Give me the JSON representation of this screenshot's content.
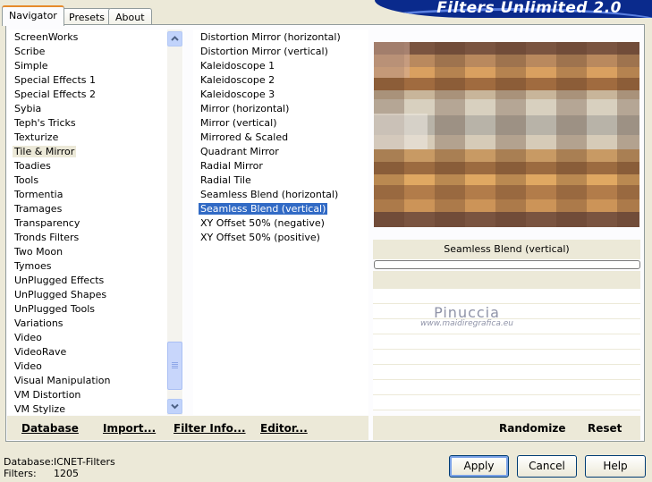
{
  "tabs": [
    {
      "label": "Navigator",
      "active": true
    },
    {
      "label": "Presets",
      "active": false
    },
    {
      "label": "About",
      "active": false
    }
  ],
  "banner_title": "Filters Unlimited 2.0",
  "categories": [
    "ScreenWorks",
    "Scribe",
    "Simple",
    "Special Effects 1",
    "Special Effects 2",
    "Sybia",
    "Teph's Tricks",
    "Texturize",
    "Tile & Mirror",
    "Toadies",
    "Tools",
    "Tormentia",
    "Tramages",
    "Transparency",
    "Tronds Filters",
    "Two Moon",
    "Tymoes",
    "UnPlugged Effects",
    "UnPlugged Shapes",
    "UnPlugged Tools",
    "Variations",
    "Video",
    "VideoRave",
    "Video",
    "Visual Manipulation",
    "VM Distortion",
    "VM Stylize"
  ],
  "selected_category": "Tile & Mirror",
  "filters": [
    "Distortion Mirror (horizontal)",
    "Distortion Mirror (vertical)",
    "Kaleidoscope 1",
    "Kaleidoscope 2",
    "Kaleidoscope 3",
    "Mirror (horizontal)",
    "Mirror (vertical)",
    "Mirrored & Scaled",
    "Quadrant Mirror",
    "Radial Mirror",
    "Radial Tile",
    "Seamless Blend (horizontal)",
    "Seamless Blend (vertical)",
    "XY Offset 50% (negative)",
    "XY Offset 50% (positive)"
  ],
  "selected_filter": "Seamless Blend (vertical)",
  "preview_filter_name": "Seamless Blend (vertical)",
  "watermark": {
    "name": "Pinuccia",
    "site": "www.maidiregrafica.eu"
  },
  "left_actions": {
    "database": "Database",
    "import": "Import...",
    "filter_info": "Filter Info...",
    "editor": "Editor..."
  },
  "right_actions": {
    "randomize": "Randomize",
    "reset": "Reset"
  },
  "status": {
    "database_label": "Database:",
    "database_value": "ICNET-Filters",
    "filters_label": "Filters:",
    "filters_value": "1205"
  },
  "buttons": {
    "apply": "Apply",
    "cancel": "Cancel",
    "help": "Help"
  },
  "colors": {
    "selection": "#316ac5",
    "banner": "#0a2a8c",
    "tab_accent": "#e68b2c"
  }
}
